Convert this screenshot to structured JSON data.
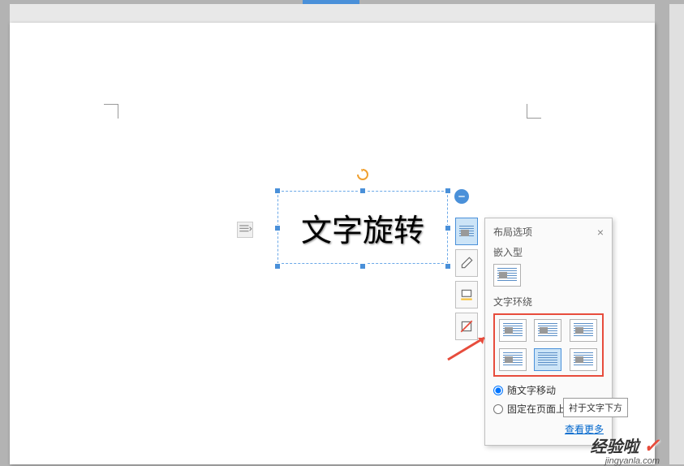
{
  "textbox": {
    "content": "文字旋转"
  },
  "layout_panel": {
    "title": "布局选项",
    "inline_label": "嵌入型",
    "wrap_label": "文字环绕",
    "radio_move_with_text": "随文字移动",
    "radio_fixed_on_page": "固定在页面上",
    "see_more": "查看更多",
    "tooltip": "衬于文字下方"
  },
  "side_tools": {
    "layout": "layout-options",
    "edit": "edit",
    "fill": "fill-color",
    "crop": "crop"
  },
  "watermark": {
    "text": "经验啦",
    "check": "✓",
    "url": "jingyanla.com"
  }
}
